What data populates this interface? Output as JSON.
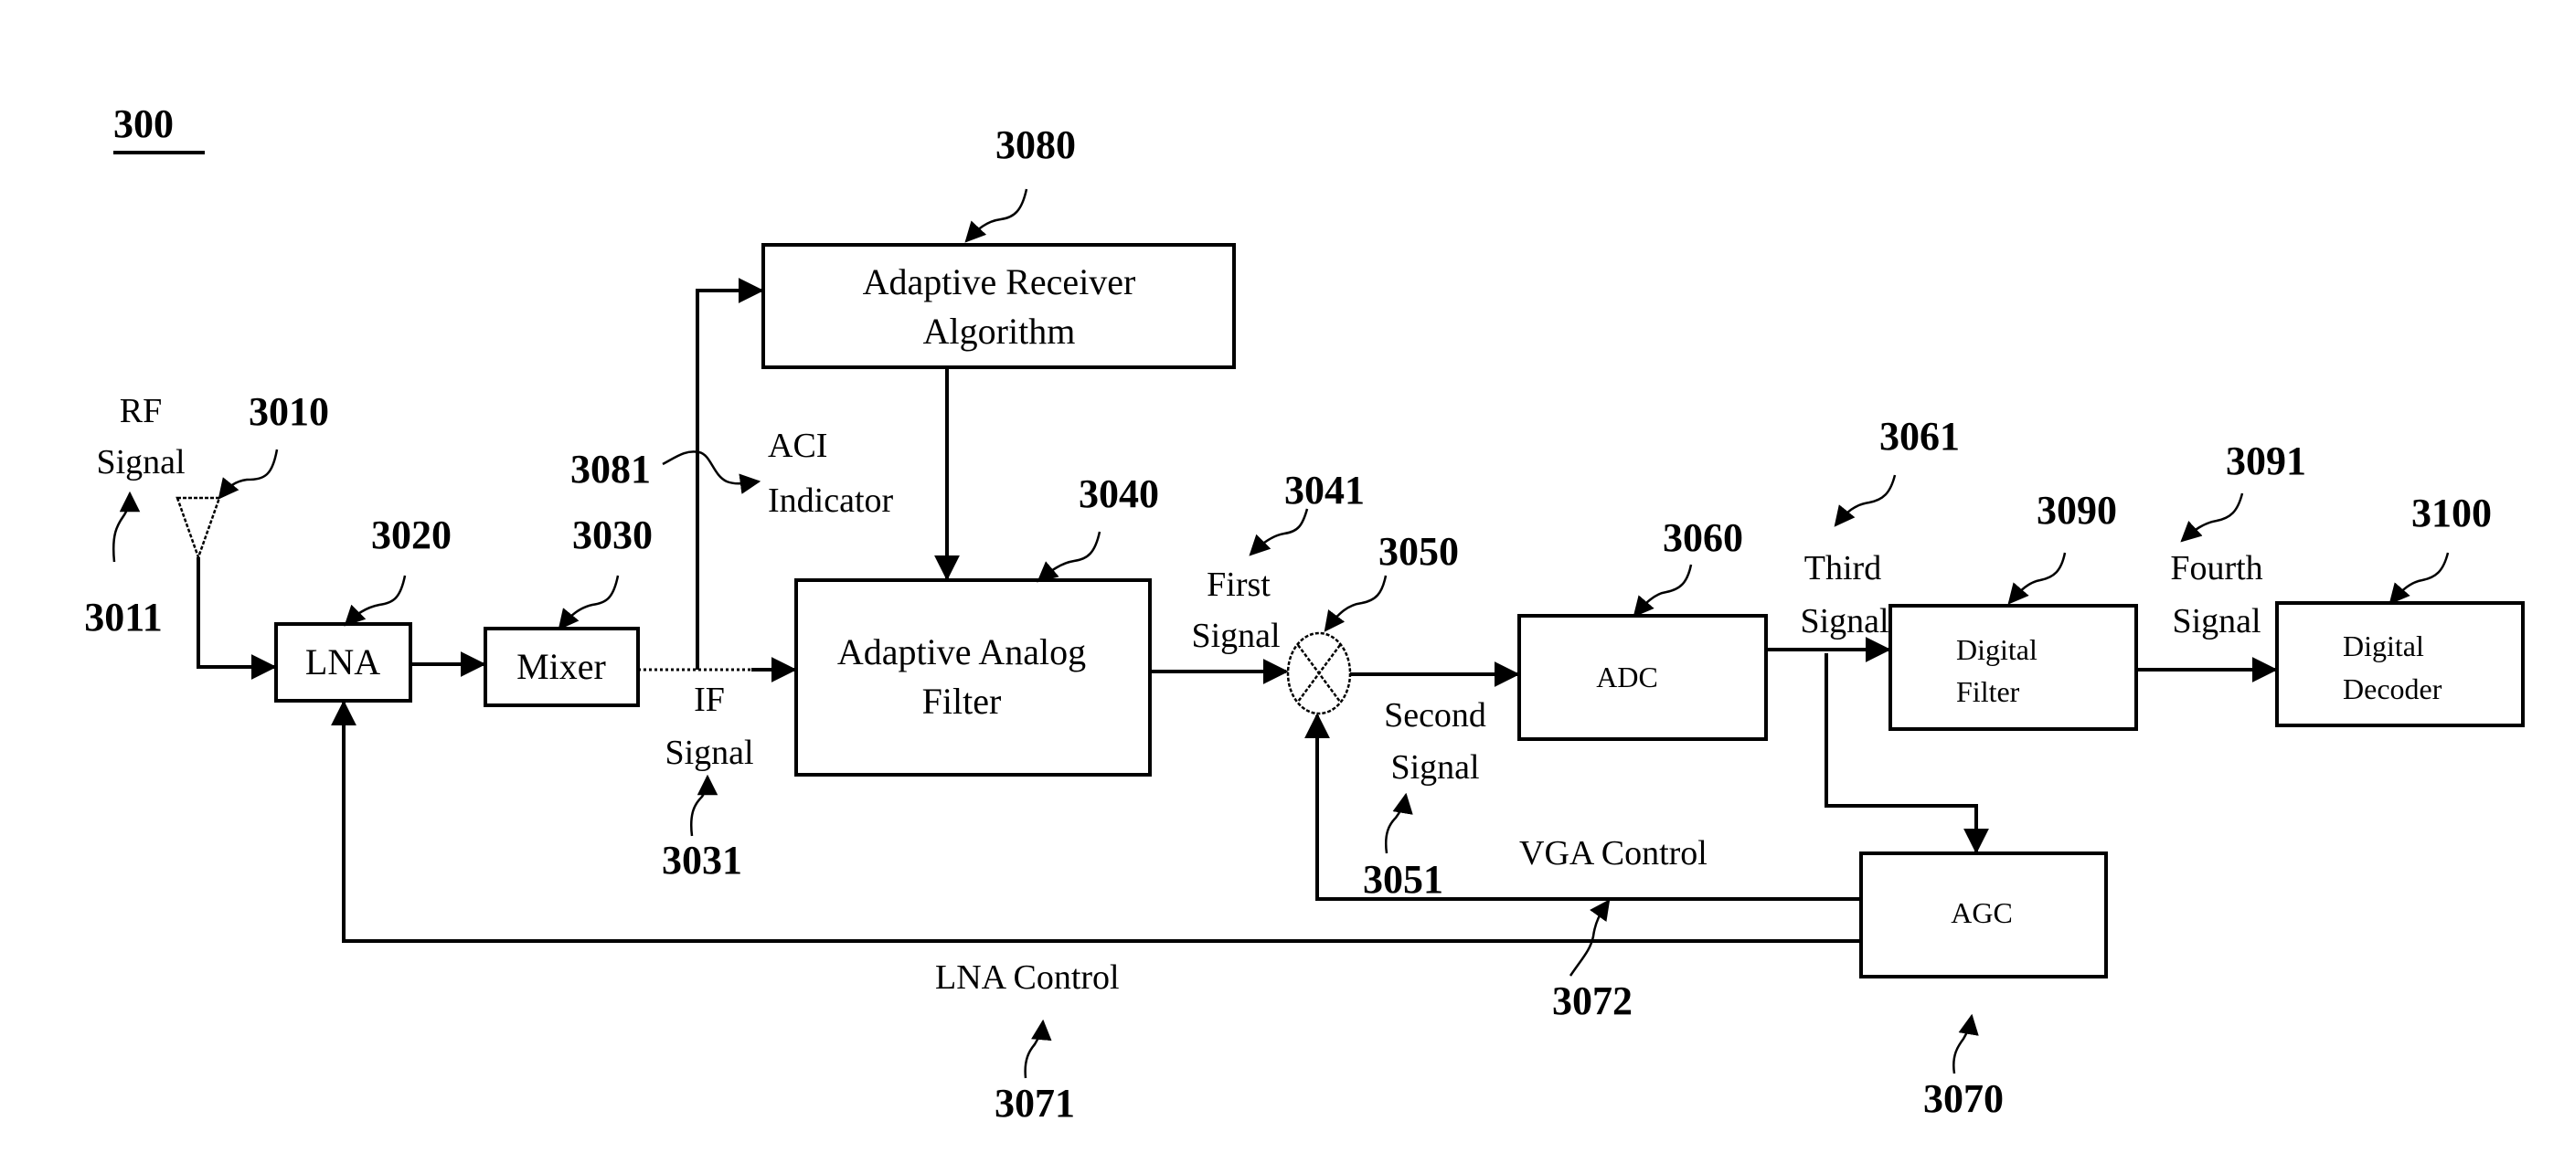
{
  "figure": {
    "number": "300",
    "blocks": {
      "lna": "LNA",
      "mixer": "Mixer",
      "adaptive_receiver": [
        "Adaptive Receiver",
        "Algorithm"
      ],
      "adaptive_filter": [
        "Adaptive Analog",
        "Filter"
      ],
      "adc": "ADC",
      "digital_filter": [
        "Digital",
        "Filter"
      ],
      "digital_decoder": [
        "Digital",
        "Decoder"
      ],
      "agc": "AGC"
    },
    "signals": {
      "rf": [
        "RF",
        "Signal"
      ],
      "if": [
        "IF",
        "Signal"
      ],
      "aci": [
        "ACI",
        "Indicator"
      ],
      "first": [
        "First",
        "Signal"
      ],
      "second": [
        "Second",
        "Signal"
      ],
      "third": [
        "Third",
        "Signal"
      ],
      "fourth": [
        "Fourth",
        "Signal"
      ],
      "vga_control": "VGA Control",
      "lna_control": "LNA Control"
    },
    "refs": {
      "antenna": "3010",
      "rf_signal": "3011",
      "lna": "3020",
      "mixer": "3030",
      "if_signal": "3031",
      "adaptive_filter": "3040",
      "first_signal": "3041",
      "multiplier": "3050",
      "second_signal": "3051",
      "adc": "3060",
      "third_signal": "3061",
      "agc": "3070",
      "lna_control": "3071",
      "vga_control": "3072",
      "adaptive_receiver": "3080",
      "aci_indicator": "3081",
      "digital_filter": "3090",
      "fourth_signal": "3091",
      "digital_decoder": "3100"
    }
  }
}
